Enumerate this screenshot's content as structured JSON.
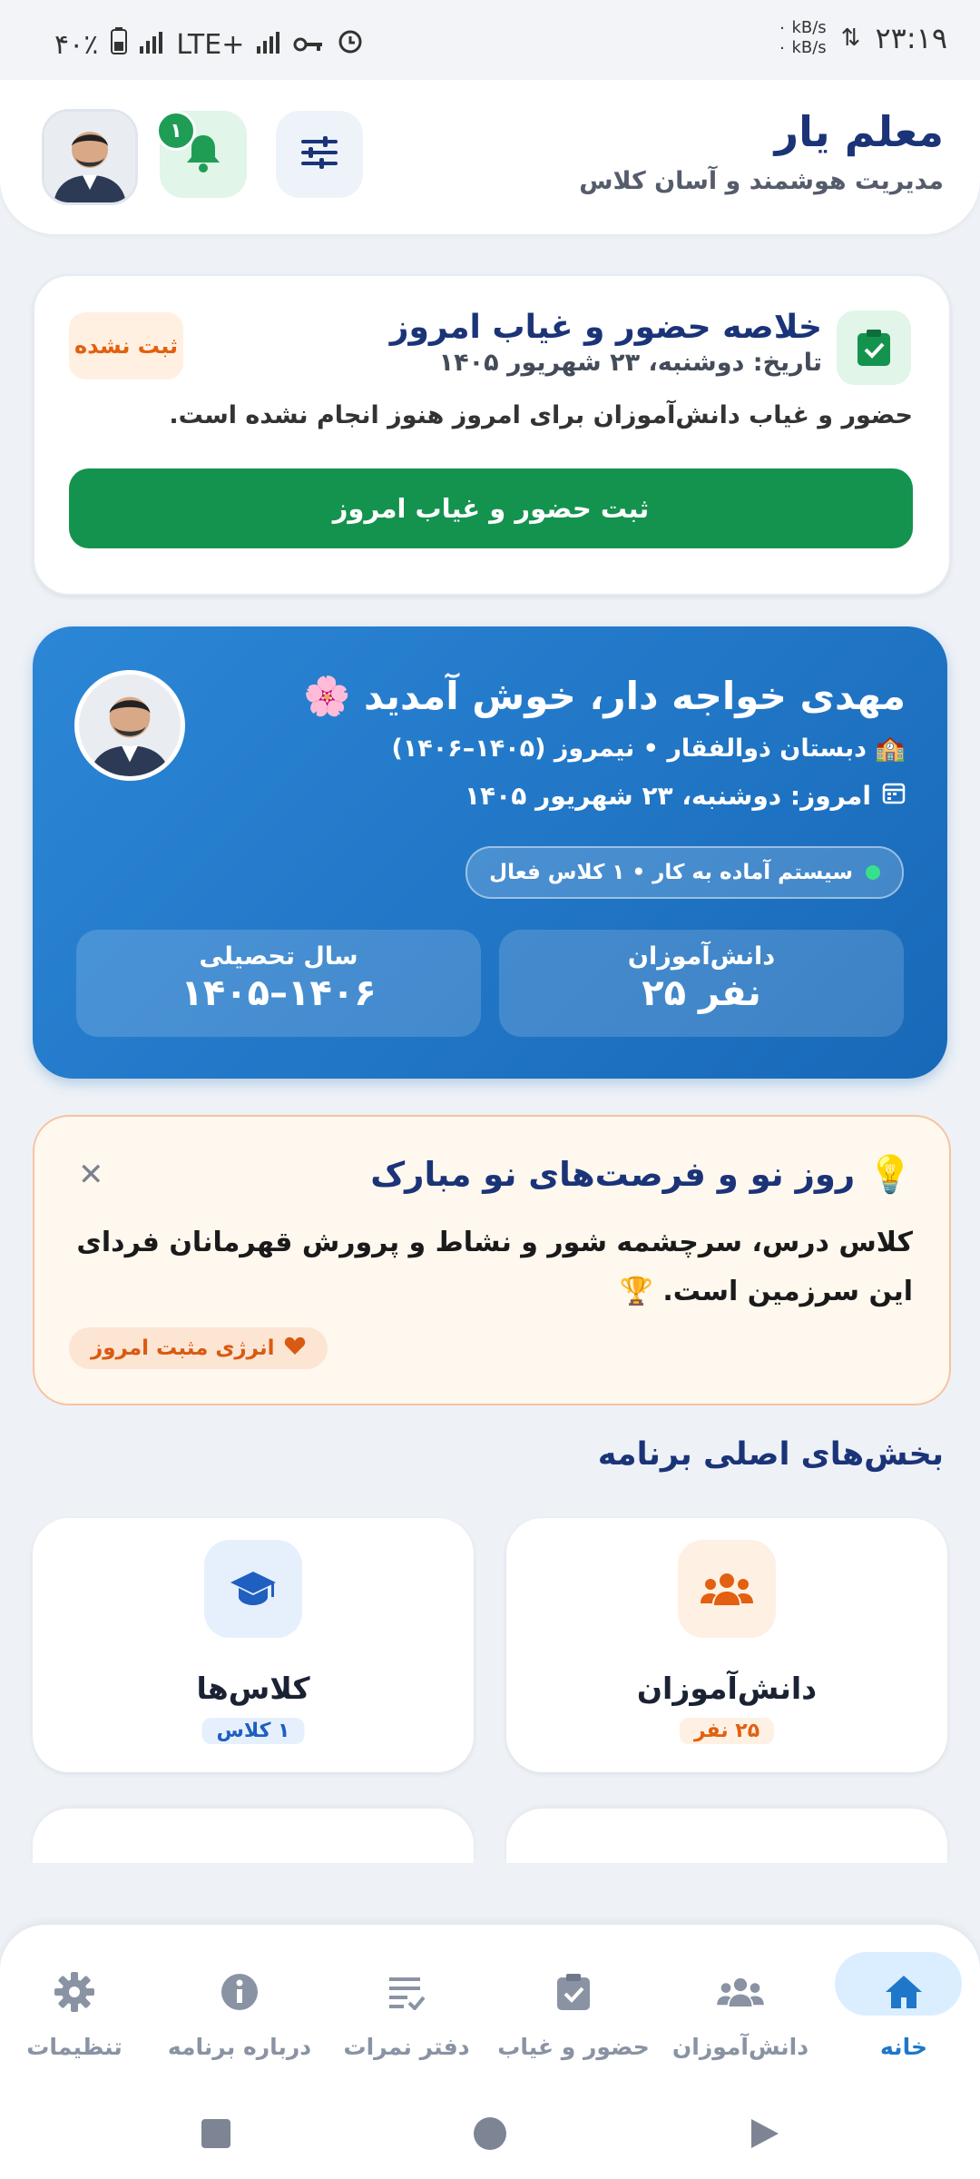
{
  "status_bar": {
    "time": "۲۳:۱۹",
    "speed_up": "۰ kB/s",
    "speed_down": "۰ kB/s",
    "battery": "۴۰٪",
    "network": "LTE+"
  },
  "header": {
    "title": "معلم یار",
    "subtitle": "مدیریت هوشمند و آسان کلاس",
    "notification_count": "۱"
  },
  "attendance": {
    "title": "خلاصه حضور و غیاب امروز",
    "date": "تاریخ: دوشنبه، ۲۳ شهریور ۱۴۰۵",
    "status": "ثبت نشده",
    "description": "حضور و غیاب دانش‌آموزان برای امروز هنوز انجام نشده است.",
    "button": "ثبت حضور و غیاب امروز"
  },
  "welcome": {
    "greeting": "مهدی خواجه دار، خوش آمدید 🌸",
    "school": "🏫 دبستان ذوالفقار • نیمروز (۱۴۰۵–۱۴۰۶)",
    "today": "امروز: دوشنبه، ۲۳ شهریور ۱۴۰۵",
    "system_status": "سیستم آماده به کار • ۱ کلاس فعال",
    "students_label": "دانش‌آموزان",
    "students_value": "۲۵ نفر",
    "year_label": "سال تحصیلی",
    "year_value": "۱۴۰۵–۱۴۰۶"
  },
  "motivation": {
    "title": "روز نو و فرصت‌های نو مبارک",
    "text": "کلاس درس، سرچشمه شور و نشاط و پرورش قهرمانان فردای این سرزمین است. 🏆",
    "pill": "انرژی مثبت امروز"
  },
  "sections": {
    "title": "بخش‌های اصلی برنامه",
    "tiles": [
      {
        "label": "دانش‌آموزان",
        "count": "۲۵ نفر"
      },
      {
        "label": "کلاس‌ها",
        "count": "۱ کلاس"
      }
    ]
  },
  "nav": {
    "items": [
      {
        "label": "خانه"
      },
      {
        "label": "دانش‌آموزان"
      },
      {
        "label": "حضور و غیاب"
      },
      {
        "label": "دفتر نمرات"
      },
      {
        "label": "درباره برنامه"
      },
      {
        "label": "تنظیمات"
      }
    ]
  },
  "colors": {
    "primary": "#1b3478",
    "green": "#14934e",
    "blue": "#1f77c9",
    "orange": "#e2600f"
  }
}
